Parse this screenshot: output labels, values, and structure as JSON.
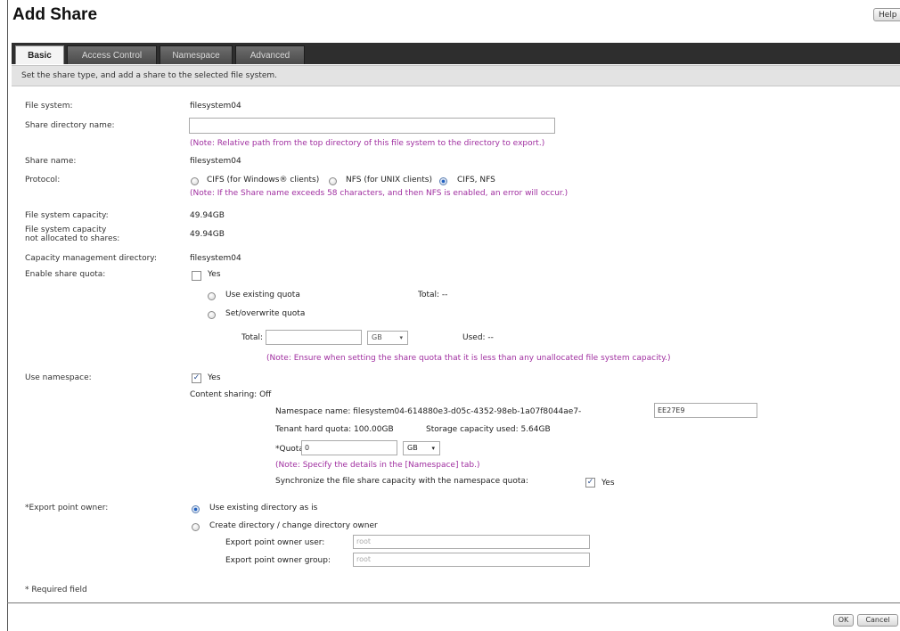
{
  "header": {
    "title": "Add Share",
    "help_label": "Help"
  },
  "tabs": [
    {
      "label": "Basic"
    },
    {
      "label": "Access Control"
    },
    {
      "label": "Namespace"
    },
    {
      "label": "Advanced"
    }
  ],
  "description": "Set the share type, and add a share to the selected file system.",
  "form": {
    "file_system": {
      "label": "File system:",
      "value": "filesystem04"
    },
    "share_dir": {
      "label": "Share directory name:",
      "value": "",
      "note": "(Note: Relative path from the top directory of this file system to the directory to export.)"
    },
    "share_name": {
      "label": "Share name:",
      "value": "filesystem04"
    },
    "protocol": {
      "label": "Protocol:",
      "options": [
        "CIFS (for Windows® clients)",
        "NFS (for UNIX clients)",
        "CIFS, NFS"
      ],
      "selected": "CIFS, NFS",
      "note": "(Note: If the Share name exceeds 58 characters, and then NFS is enabled, an error will occur.)"
    },
    "fs_capacity": {
      "label": "File system capacity:",
      "value": "49.94GB"
    },
    "fs_capacity_unalloc": {
      "label_line1": "File system capacity",
      "label_line2": "not allocated to shares:",
      "value": "49.94GB"
    },
    "cap_mgmt_dir": {
      "label": "Capacity management directory:",
      "value": "filesystem04"
    },
    "share_quota": {
      "label": "Enable share quota:",
      "checkbox_label": "Yes",
      "checked": false,
      "use_existing": "Use existing quota",
      "total_existing": "Total: --",
      "set_overwrite": "Set/overwrite quota",
      "total_label": "Total:",
      "total_value": "",
      "unit": "GB",
      "used": "Used: --",
      "note": "(Note: Ensure when setting the share quota that it is less than any unallocated file system capacity.)"
    },
    "namespace": {
      "label": "Use namespace:",
      "checkbox_label": "Yes",
      "checked": true,
      "content_sharing": "Content sharing: Off",
      "ns_name_label": "Namespace name: filesystem04-614880e3-d05c-4352-98eb-1a07f8044ae7-",
      "ns_name_value": "EE27E9",
      "tenant_quota": "Tenant hard quota: 100.00GB",
      "storage_used": "Storage capacity used: 5.64GB",
      "quota_label": "*Quota:",
      "quota_value": "0",
      "quota_unit": "GB",
      "note": "(Note: Specify the details in the [Namespace] tab.)",
      "sync_label": "Synchronize the file share capacity with the namespace quota:",
      "sync_checkbox_label": "Yes",
      "sync_checked": true
    },
    "export_owner": {
      "label": "*Export point owner:",
      "option_existing": "Use existing directory as is",
      "option_create": "Create directory / change directory owner",
      "selected": "existing",
      "user_label": "Export point owner user:",
      "user_placeholder": "root",
      "group_label": "Export point owner group:",
      "group_placeholder": "root"
    },
    "required_note": "* Required field"
  },
  "footer": {
    "ok_label": "OK",
    "cancel_label": "Cancel"
  },
  "colors": {
    "note": "#a02fa0",
    "tabbar": "#2e2e2e",
    "accent": "#2060c0"
  }
}
